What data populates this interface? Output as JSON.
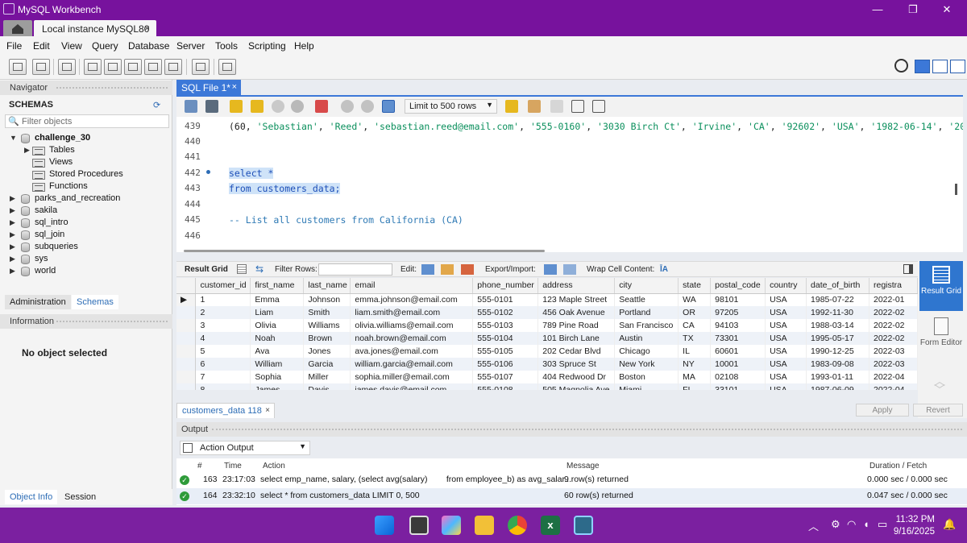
{
  "window": {
    "title": "MySQL Workbench",
    "minimize_icon": "—",
    "maximize_icon": "❐",
    "close_icon": "✕"
  },
  "connection_tab": {
    "label": "Local instance MySQL80",
    "close": "×"
  },
  "menu": [
    "File",
    "Edit",
    "View",
    "Query",
    "Database",
    "Server",
    "Tools",
    "Scripting",
    "Help"
  ],
  "navigator": {
    "title": "Navigator",
    "schemas_label": "SCHEMAS",
    "filter_placeholder": "Filter objects",
    "schemas": [
      {
        "name": "challenge_30",
        "expanded": true
      },
      {
        "name": "parks_and_recreation"
      },
      {
        "name": "sakila"
      },
      {
        "name": "sql_intro"
      },
      {
        "name": "sql_join"
      },
      {
        "name": "subqueries"
      },
      {
        "name": "sys"
      },
      {
        "name": "world"
      }
    ],
    "children": [
      "Tables",
      "Views",
      "Stored Procedures",
      "Functions"
    ],
    "tabs": {
      "administration": "Administration",
      "schemas": "Schemas"
    },
    "information_title": "Information",
    "no_object": "No object selected",
    "bottom_tabs": {
      "object_info": "Object Info",
      "session": "Session"
    }
  },
  "editor_tab": {
    "label": "SQL File 1*",
    "close": "×"
  },
  "editor_toolbar": {
    "limit": "Limit to 500 rows"
  },
  "editor": {
    "lines": [
      {
        "num": "439",
        "code": "(60, 'Sebastian', 'Reed', 'sebastian.reed@email.com', '555-0160', '3030 Birch Ct', 'Irvine', 'CA', '92602', 'USA', '1982-06-14', '2024-0"
      },
      {
        "num": "440",
        "code": ""
      },
      {
        "num": "441",
        "code": ""
      },
      {
        "num": "442",
        "code": "select *"
      },
      {
        "num": "443",
        "code": "from customers_data;"
      },
      {
        "num": "444",
        "code": ""
      },
      {
        "num": "445",
        "code": "-- List all customers from California (CA)"
      },
      {
        "num": "446",
        "code": ""
      }
    ]
  },
  "result_toolbar": {
    "result_grid": "Result Grid",
    "filter_rows": "Filter Rows:",
    "edit": "Edit:",
    "export_import": "Export/Import:",
    "wrap": "Wrap Cell Content:"
  },
  "grid": {
    "columns": [
      "customer_id",
      "first_name",
      "last_name",
      "email",
      "phone_number",
      "address",
      "city",
      "state",
      "postal_code",
      "country",
      "date_of_birth",
      "registra"
    ],
    "rows": [
      [
        "1",
        "Emma",
        "Johnson",
        "emma.johnson@email.com",
        "555-0101",
        "123 Maple Street",
        "Seattle",
        "WA",
        "98101",
        "USA",
        "1985-07-22",
        "2022-01"
      ],
      [
        "2",
        "Liam",
        "Smith",
        "liam.smith@email.com",
        "555-0102",
        "456 Oak Avenue",
        "Portland",
        "OR",
        "97205",
        "USA",
        "1992-11-30",
        "2022-02"
      ],
      [
        "3",
        "Olivia",
        "Williams",
        "olivia.williams@email.com",
        "555-0103",
        "789 Pine Road",
        "San Francisco",
        "CA",
        "94103",
        "USA",
        "1988-03-14",
        "2022-02"
      ],
      [
        "4",
        "Noah",
        "Brown",
        "noah.brown@email.com",
        "555-0104",
        "101 Birch Lane",
        "Austin",
        "TX",
        "73301",
        "USA",
        "1995-05-17",
        "2022-02"
      ],
      [
        "5",
        "Ava",
        "Jones",
        "ava.jones@email.com",
        "555-0105",
        "202 Cedar Blvd",
        "Chicago",
        "IL",
        "60601",
        "USA",
        "1990-12-25",
        "2022-03"
      ],
      [
        "6",
        "William",
        "Garcia",
        "william.garcia@email.com",
        "555-0106",
        "303 Spruce St",
        "New York",
        "NY",
        "10001",
        "USA",
        "1983-09-08",
        "2022-03"
      ],
      [
        "7",
        "Sophia",
        "Miller",
        "sophia.miller@email.com",
        "555-0107",
        "404 Redwood Dr",
        "Boston",
        "MA",
        "02108",
        "USA",
        "1993-01-11",
        "2022-04"
      ],
      [
        "8",
        "James",
        "Davis",
        "james.davis@email.com",
        "555-0108",
        "505 Magnolia Ave",
        "Miami",
        "FL",
        "33101",
        "USA",
        "1987-06-09",
        "2022-04"
      ]
    ]
  },
  "side_panel": {
    "result_grid": "Result Grid",
    "form_editor": "Form Editor"
  },
  "result_tab": {
    "label": "customers_data 118",
    "close": "×"
  },
  "buttons": {
    "apply": "Apply",
    "revert": "Revert"
  },
  "output": {
    "title": "Output",
    "selector": "Action Output",
    "headers": {
      "num": "#",
      "time": "Time",
      "action": "Action",
      "message": "Message",
      "duration": "Duration / Fetch"
    },
    "rows": [
      {
        "num": "163",
        "time": "23:17:03",
        "action": "select emp_name, salary, (select avg(salary)        from employee_b) as avg_salar...",
        "message": "9 row(s) returned",
        "duration": "0.000 sec / 0.000 sec"
      },
      {
        "num": "164",
        "time": "23:32:10",
        "action": "select * from customers_data LIMIT 0, 500",
        "message": "60 row(s) returned",
        "duration": "0.047 sec / 0.000 sec"
      }
    ]
  },
  "taskbar": {
    "time": "11:32 PM",
    "date": "9/16/2025"
  }
}
